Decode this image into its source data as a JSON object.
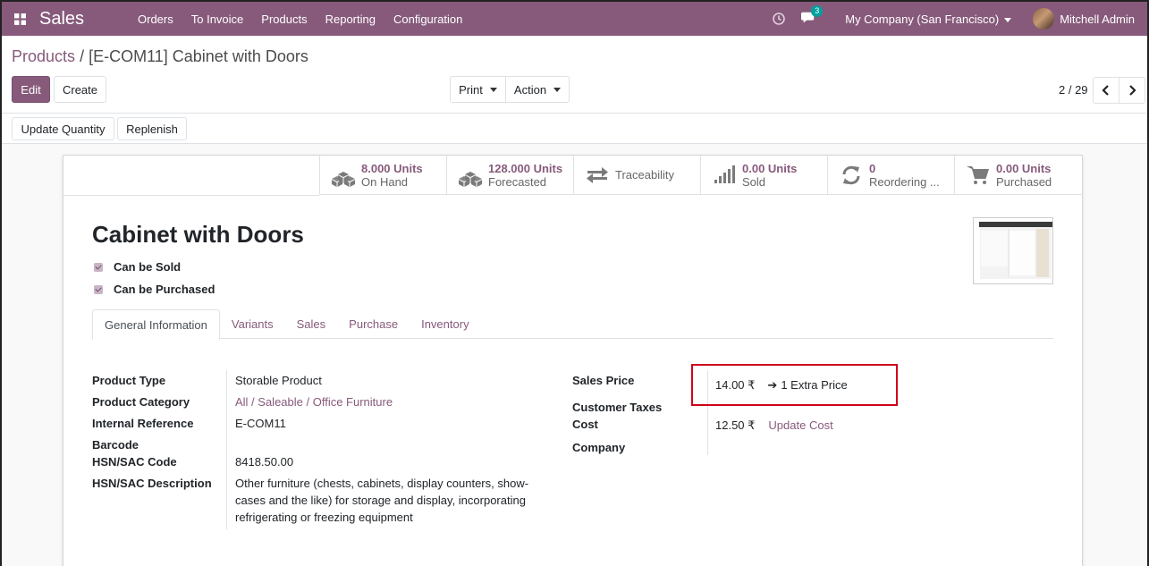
{
  "navbar": {
    "app_name": "Sales",
    "menu": [
      "Orders",
      "To Invoice",
      "Products",
      "Reporting",
      "Configuration"
    ],
    "chat_badge": "3",
    "company": "My Company (San Francisco)",
    "user": "Mitchell Admin"
  },
  "breadcrumb": {
    "parent": "Products",
    "separator": "/",
    "current": "[E-COM11] Cabinet with Doors"
  },
  "buttons": {
    "edit": "Edit",
    "create": "Create",
    "print": "Print",
    "action": "Action",
    "update_quantity": "Update Quantity",
    "replenish": "Replenish"
  },
  "pager": {
    "value": "2 / 29"
  },
  "smart_buttons": [
    {
      "value": "8.000 Units",
      "label": "On Hand",
      "icon": "cubes-icon"
    },
    {
      "value": "128.000 Units",
      "label": "Forecasted",
      "icon": "cubes-icon"
    },
    {
      "label": "Traceability",
      "icon": "exchange-icon"
    },
    {
      "value": "0.00 Units",
      "label": "Sold",
      "icon": "signal-icon"
    },
    {
      "value": "0",
      "label": "Reordering ...",
      "icon": "refresh-icon"
    },
    {
      "value": "0.00 Units",
      "label": "Purchased",
      "icon": "cart-icon"
    }
  ],
  "product": {
    "title": "Cabinet with Doors",
    "can_be_sold": "Can be Sold",
    "can_be_purchased": "Can be Purchased"
  },
  "tabs": [
    "General Information",
    "Variants",
    "Sales",
    "Purchase",
    "Inventory"
  ],
  "left_fields": {
    "product_type_label": "Product Type",
    "product_type": "Storable Product",
    "category_label": "Product Category",
    "category": "All / Saleable / Office Furniture",
    "internal_ref_label": "Internal Reference",
    "internal_ref": "E-COM11",
    "barcode_label": "Barcode",
    "hsn_code_label": "HSN/SAC Code",
    "hsn_code": "8418.50.00",
    "hsn_desc_label": "HSN/SAC Description",
    "hsn_desc": "Other furniture (chests, cabinets, display counters, show-cases and the like) for storage and display, incorporating refrigerating or freezing equipment"
  },
  "right_fields": {
    "sales_price_label": "Sales Price",
    "sales_price": "14.00 ₹",
    "extra_price": "1 Extra Price",
    "customer_taxes_label": "Customer Taxes",
    "cost_label": "Cost",
    "cost": "12.50 ₹",
    "update_cost": "Update Cost",
    "company_label": "Company"
  },
  "colors": {
    "brand": "#875a7b",
    "highlight": "#d0021b"
  }
}
